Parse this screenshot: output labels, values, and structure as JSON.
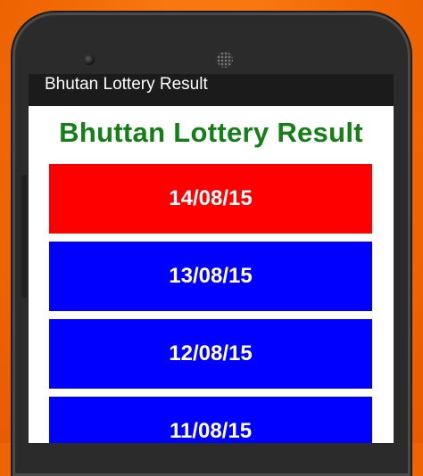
{
  "app": {
    "title": "Bhutan Lottery Result"
  },
  "main": {
    "heading": "Bhuttan Lottery Result"
  },
  "dates": [
    {
      "label": "14/08/15",
      "color": "#ff0000"
    },
    {
      "label": "13/08/15",
      "color": "#0000ff"
    },
    {
      "label": "12/08/15",
      "color": "#0000ff"
    },
    {
      "label": "11/08/15",
      "color": "#0000ff"
    }
  ]
}
